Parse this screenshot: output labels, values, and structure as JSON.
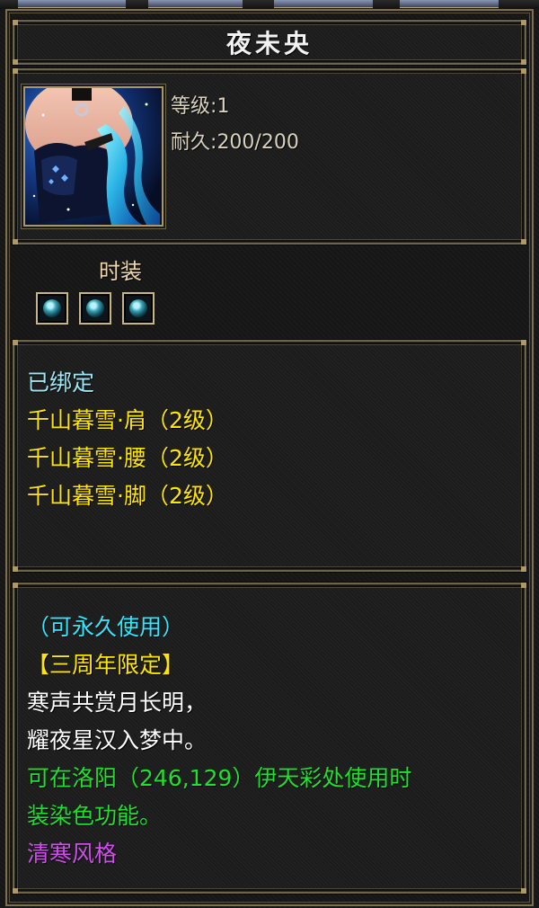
{
  "item": {
    "name": "夜未央",
    "stats": [
      {
        "label": "等级",
        "value": "1"
      },
      {
        "label": "耐久",
        "value": "200/200"
      }
    ],
    "icon": "fashion-costume-portrait"
  },
  "fashion": {
    "label": "时装",
    "slots": [
      "gem-slot",
      "gem-slot",
      "gem-slot"
    ]
  },
  "set_info": {
    "bound": "已绑定",
    "set_items": [
      "千山暮雪·肩（2级）",
      "千山暮雪·腰（2级）",
      "千山暮雪·脚（2级）"
    ]
  },
  "description": {
    "duration": "（可永久使用）",
    "tag": "【三周年限定】",
    "poem_line1": "寒声共赏月长明，",
    "poem_line2": "耀夜星汉入梦中。",
    "usage_line1": "可在洛阳（246,129）伊天彩处使用时",
    "usage_line2": "装染色功能。",
    "style": "清寒风格"
  },
  "colors": {
    "bound": "#9be6f5",
    "set_item": "#ffe600",
    "duration": "#33e6ff",
    "tag": "#ffe600",
    "poem": "#ffffff",
    "usage": "#1ee12e",
    "style": "#d24cf0",
    "frame": "#7d6f4f"
  }
}
